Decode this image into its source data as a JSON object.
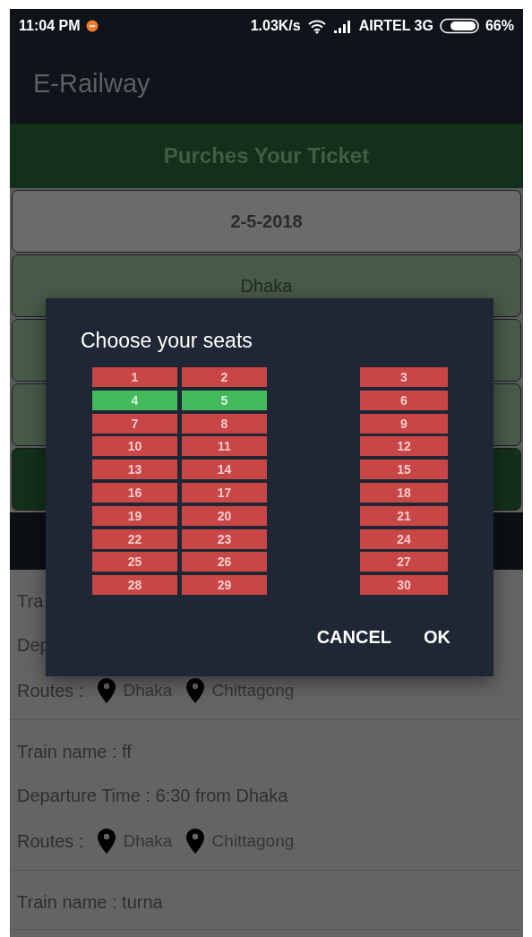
{
  "status_bar": {
    "time": "11:04 PM",
    "speed": "1.03K/s",
    "carrier": "AIRTEL 3G",
    "battery": "66%"
  },
  "app_bar": {
    "title": "E-Railway"
  },
  "header": {
    "title": "Purches Your Ticket"
  },
  "fields": [
    {
      "kind": "date",
      "value": "2-5-2018"
    },
    {
      "kind": "station",
      "value": "Dhaka"
    },
    {
      "kind": "station"
    },
    {
      "kind": "station"
    },
    {
      "kind": "submit"
    }
  ],
  "trains": [
    {
      "name_line": "Tra",
      "departure_line": "Dep",
      "routes_label": "Routes :",
      "stops": [
        "Dhaka",
        "Chittagong"
      ]
    },
    {
      "name_line": "Train name : ff",
      "departure_line": "Departure Time : 6:30 from Dhaka",
      "routes_label": "Routes :",
      "stops": [
        "Dhaka",
        "Chittagong"
      ]
    },
    {
      "name_line": "Train name : turna"
    }
  ],
  "dialog": {
    "title": "Choose your seats",
    "seats": [
      {
        "number": "1",
        "selected": false
      },
      {
        "number": "2",
        "selected": false
      },
      {
        "number": "3",
        "selected": false
      },
      {
        "number": "4",
        "selected": true
      },
      {
        "number": "5",
        "selected": true
      },
      {
        "number": "6",
        "selected": false
      },
      {
        "number": "7",
        "selected": false
      },
      {
        "number": "8",
        "selected": false
      },
      {
        "number": "9",
        "selected": false
      },
      {
        "number": "10",
        "selected": false
      },
      {
        "number": "11",
        "selected": false
      },
      {
        "number": "12",
        "selected": false
      },
      {
        "number": "13",
        "selected": false
      },
      {
        "number": "14",
        "selected": false
      },
      {
        "number": "15",
        "selected": false
      },
      {
        "number": "16",
        "selected": false
      },
      {
        "number": "17",
        "selected": false
      },
      {
        "number": "18",
        "selected": false
      },
      {
        "number": "19",
        "selected": false
      },
      {
        "number": "20",
        "selected": false
      },
      {
        "number": "21",
        "selected": false
      },
      {
        "number": "22",
        "selected": false
      },
      {
        "number": "23",
        "selected": false
      },
      {
        "number": "24",
        "selected": false
      },
      {
        "number": "25",
        "selected": false
      },
      {
        "number": "26",
        "selected": false
      },
      {
        "number": "27",
        "selected": false
      },
      {
        "number": "28",
        "selected": false
      },
      {
        "number": "29",
        "selected": false
      },
      {
        "number": "30",
        "selected": false
      }
    ],
    "buttons": [
      "CANCEL",
      "OK"
    ]
  }
}
